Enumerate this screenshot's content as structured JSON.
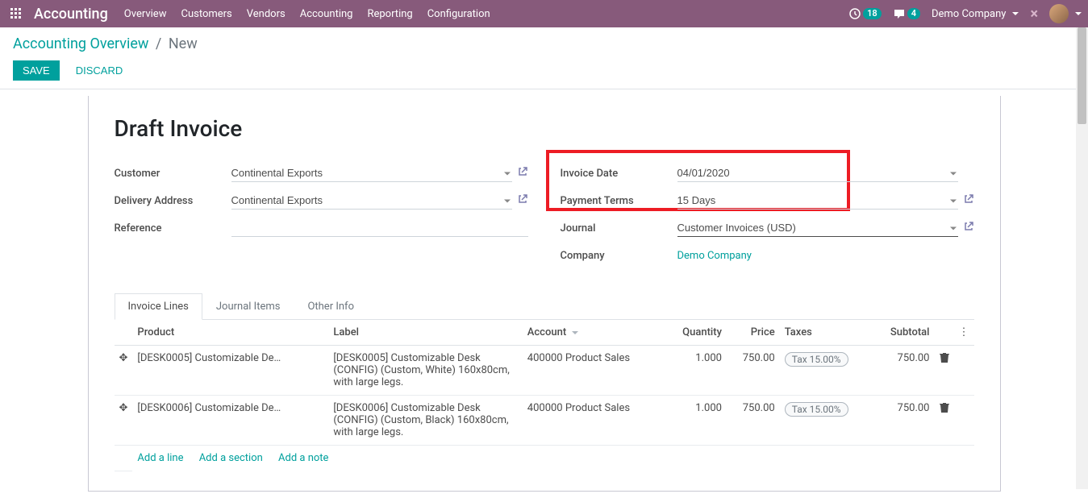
{
  "nav": {
    "brand": "Accounting",
    "items": [
      "Overview",
      "Customers",
      "Vendors",
      "Accounting",
      "Reporting",
      "Configuration"
    ],
    "timer_badge": "18",
    "chat_badge": "4",
    "company": "Demo Company"
  },
  "breadcrumb": {
    "parent": "Accounting Overview",
    "current": "New"
  },
  "buttons": {
    "save": "Save",
    "discard": "Discard"
  },
  "form": {
    "title": "Draft Invoice",
    "left": {
      "customer_label": "Customer",
      "customer_value": "Continental Exports",
      "delivery_label": "Delivery Address",
      "delivery_value": "Continental Exports",
      "reference_label": "Reference",
      "reference_value": ""
    },
    "right": {
      "invoice_date_label": "Invoice Date",
      "invoice_date_value": "04/01/2020",
      "payment_terms_label": "Payment Terms",
      "payment_terms_value": "15 Days",
      "journal_label": "Journal",
      "journal_value": "Customer Invoices (USD)",
      "company_label": "Company",
      "company_value": "Demo Company"
    }
  },
  "tabs": [
    "Invoice Lines",
    "Journal Items",
    "Other Info"
  ],
  "table": {
    "headers": {
      "product": "Product",
      "label": "Label",
      "account": "Account",
      "quantity": "Quantity",
      "price": "Price",
      "taxes": "Taxes",
      "subtotal": "Subtotal"
    },
    "rows": [
      {
        "product": "[DESK0005] Customizable Des...",
        "label": "[DESK0005] Customizable Desk (CONFIG) (Custom, White) 160x80cm, with large legs.",
        "account": "400000 Product Sales",
        "quantity": "1.000",
        "price": "750.00",
        "tax": "Tax 15.00%",
        "subtotal": "750.00"
      },
      {
        "product": "[DESK0006] Customizable Des...",
        "label": "[DESK0006] Customizable Desk (CONFIG) (Custom, Black) 160x80cm, with large legs.",
        "account": "400000 Product Sales",
        "quantity": "1.000",
        "price": "750.00",
        "tax": "Tax 15.00%",
        "subtotal": "750.00"
      }
    ],
    "add_line": "Add a line",
    "add_section": "Add a section",
    "add_note": "Add a note"
  }
}
